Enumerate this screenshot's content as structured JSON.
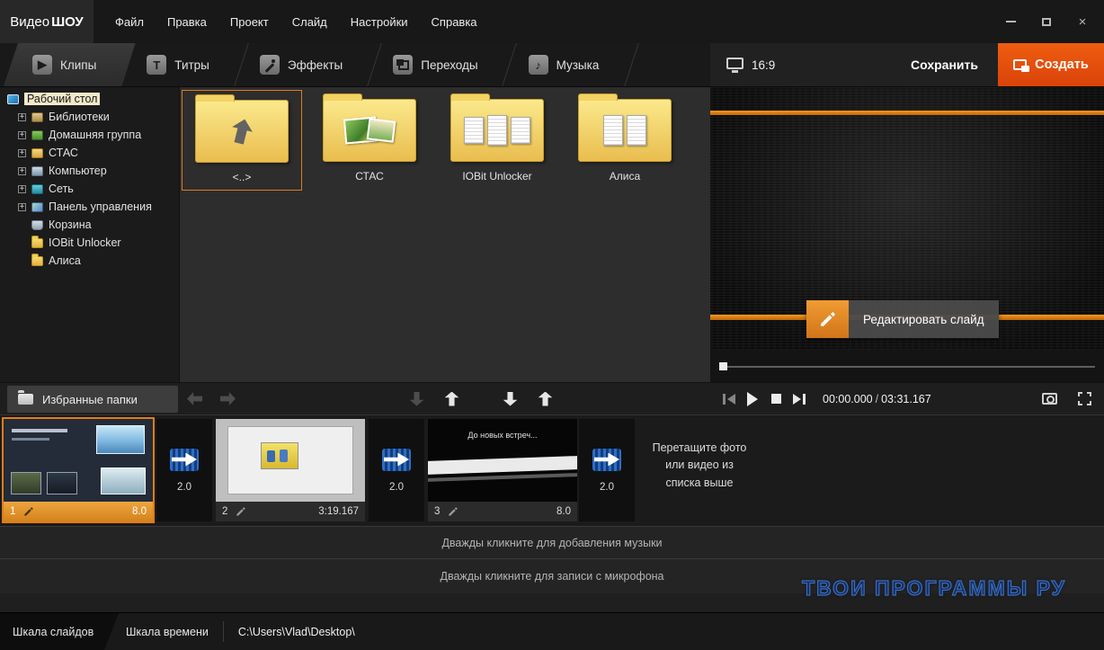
{
  "window": {
    "logo_part1": "Видео",
    "logo_part2": "ШОУ"
  },
  "menu": {
    "items": [
      "Файл",
      "Правка",
      "Проект",
      "Слайд",
      "Настройки",
      "Справка"
    ]
  },
  "tabs": [
    {
      "label": "Клипы",
      "icon": "play"
    },
    {
      "label": "Титры",
      "icon": "letter-T"
    },
    {
      "label": "Эффекты",
      "icon": "magic-wand"
    },
    {
      "label": "Переходы",
      "icon": "overlapping-frames"
    },
    {
      "label": "Музыка",
      "icon": "music-note"
    }
  ],
  "preview": {
    "aspect_ratio": "16:9",
    "save_label": "Сохранить",
    "create_label": "Создать",
    "edit_slide_label": "Редактировать слайд",
    "time_current": "00:00.000",
    "time_separator": "/",
    "time_total": "03:31.167"
  },
  "tree": {
    "items": [
      {
        "label": "Рабочий стол",
        "icon": "desktop",
        "selected": true
      },
      {
        "label": "Библиотеки",
        "icon": "libraries",
        "expandable": true
      },
      {
        "label": "Домашняя группа",
        "icon": "homegroup",
        "expandable": true
      },
      {
        "label": "СТАС",
        "icon": "user-folder",
        "expandable": true
      },
      {
        "label": "Компьютер",
        "icon": "computer",
        "expandable": true
      },
      {
        "label": "Сеть",
        "icon": "network",
        "expandable": true
      },
      {
        "label": "Панель управления",
        "icon": "control-panel",
        "expandable": true
      },
      {
        "label": "Корзина",
        "icon": "recycle-bin"
      },
      {
        "label": "IOBit Unlocker",
        "icon": "folder"
      },
      {
        "label": "Алиса",
        "icon": "folder"
      }
    ]
  },
  "browser": {
    "items": [
      {
        "label": "<..>",
        "type": "up-folder",
        "selected": true
      },
      {
        "label": "СТАС",
        "type": "folder-with-photos"
      },
      {
        "label": "IOBit Unlocker",
        "type": "folder-with-documents"
      },
      {
        "label": "Алиса",
        "type": "folder-with-documents"
      }
    ]
  },
  "favorites_label": "Избранные папки",
  "timeline": {
    "slides": [
      {
        "number": "1",
        "duration": "8.0",
        "selected": true
      },
      {
        "number": "2",
        "duration": "3:19.167"
      },
      {
        "number": "3",
        "duration": "8.0",
        "thumb_text": "До новых встреч..."
      }
    ],
    "transitions": [
      "2.0",
      "2.0",
      "2.0"
    ],
    "drop_hint": "Перетащите фото или видео из списка выше"
  },
  "tracks": {
    "music_hint": "Дважды кликните для добавления музыки",
    "voice_hint": "Дважды кликните для записи с микрофона"
  },
  "watermark": "ТВОИ ПРОГРАММЫ РУ",
  "statusbar": {
    "slides_tab": "Шкала слайдов",
    "time_tab": "Шкала времени",
    "path": "C:\\Users\\Vlad\\Desktop\\"
  },
  "icons": {
    "close": "×",
    "plus": "+",
    "play_glyph": "▶",
    "titles_glyph": "T",
    "music_glyph": "♪"
  },
  "colors": {
    "accent_orange": "#e07b1a",
    "create_button": "#e2500e",
    "transition_blue": "#2f6ec4"
  }
}
